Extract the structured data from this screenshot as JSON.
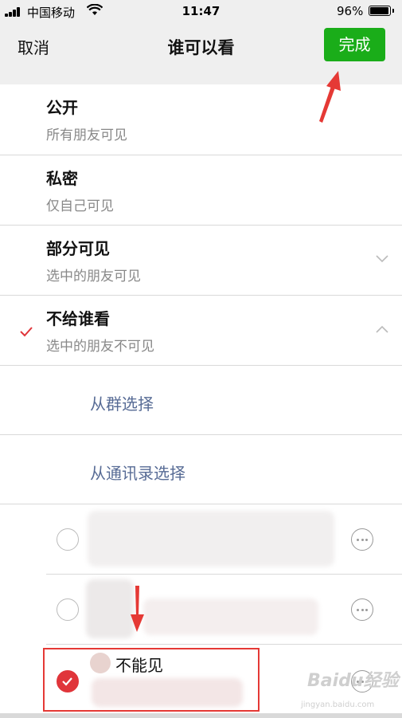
{
  "status_bar": {
    "carrier": "中国移动",
    "time": "11:47",
    "battery": "96%",
    "battery_level": 0.96
  },
  "nav": {
    "cancel_label": "取消",
    "title": "谁可以看",
    "done_label": "完成"
  },
  "options": [
    {
      "title": "公开",
      "subtitle": "所有朋友可见",
      "selected": false,
      "expandable": false
    },
    {
      "title": "私密",
      "subtitle": "仅自己可见",
      "selected": false,
      "expandable": false
    },
    {
      "title": "部分可见",
      "subtitle": "选中的朋友可见",
      "selected": false,
      "expandable": true,
      "chevron": "chevron-down-icon"
    },
    {
      "title": "不给谁看",
      "subtitle": "选中的朋友不可见",
      "selected": true,
      "expandable": true,
      "chevron": "chevron-up-icon"
    }
  ],
  "sub_options": [
    {
      "label": "从群选择"
    },
    {
      "label": "从通讯录选择"
    }
  ],
  "contacts": [
    {
      "name": "",
      "checked": false
    },
    {
      "name": "",
      "checked": false
    },
    {
      "name": "不能见",
      "checked": true
    }
  ],
  "watermark": {
    "brand": "Baidu经验",
    "url": "jingyan.baidu.com"
  },
  "colors": {
    "accent_green": "#1aad19",
    "check_red": "#e0353a",
    "link_blue": "#576b95",
    "annotation_red": "#e53935"
  }
}
